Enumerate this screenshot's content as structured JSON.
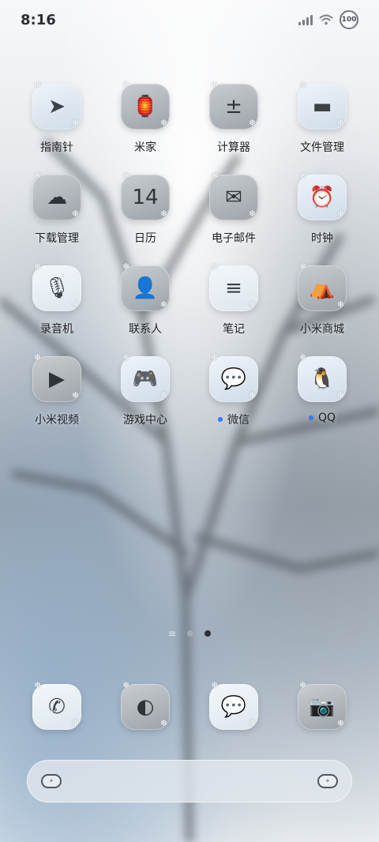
{
  "status": {
    "time": "8:16",
    "battery": "100"
  },
  "apps": [
    {
      "label": "指南针",
      "icon": "compass-icon",
      "glyph": "➤",
      "style": "blue",
      "dot": false
    },
    {
      "label": "米家",
      "icon": "lamp-icon",
      "glyph": "🏮",
      "style": "dark",
      "dot": false
    },
    {
      "label": "计算器",
      "icon": "calculator-icon",
      "glyph": "±",
      "style": "dark",
      "dot": false
    },
    {
      "label": "文件管理",
      "icon": "folder-icon",
      "glyph": "▬",
      "style": "blue",
      "dot": false
    },
    {
      "label": "下载管理",
      "icon": "cloud-download-icon",
      "glyph": "☁",
      "style": "dark",
      "dot": false
    },
    {
      "label": "日历",
      "icon": "calendar-icon",
      "glyph": "14",
      "style": "dark",
      "dot": false
    },
    {
      "label": "电子邮件",
      "icon": "mail-icon",
      "glyph": "✉",
      "style": "dark",
      "dot": false
    },
    {
      "label": "时钟",
      "icon": "alarm-clock-icon",
      "glyph": "⏰",
      "style": "blue",
      "dot": false
    },
    {
      "label": "录音机",
      "icon": "microphone-icon",
      "glyph": "🎙",
      "style": "light",
      "dot": false
    },
    {
      "label": "联系人",
      "icon": "contact-icon",
      "glyph": "👤",
      "style": "dark",
      "dot": false
    },
    {
      "label": "笔记",
      "icon": "notes-icon",
      "glyph": "≡",
      "style": "light",
      "dot": false
    },
    {
      "label": "小米商城",
      "icon": "store-icon",
      "glyph": "⛺",
      "style": "dark",
      "dot": false
    },
    {
      "label": "小米视频",
      "icon": "video-icon",
      "glyph": "▶",
      "style": "dark",
      "dot": false
    },
    {
      "label": "游戏中心",
      "icon": "gamepad-icon",
      "glyph": "🎮",
      "style": "blue",
      "dot": false
    },
    {
      "label": "微信",
      "icon": "wechat-icon",
      "glyph": "💬",
      "style": "blue",
      "dot": true
    },
    {
      "label": "QQ",
      "icon": "qq-penguin-icon",
      "glyph": "🐧",
      "style": "blue",
      "dot": true
    }
  ],
  "dock": [
    {
      "icon": "phone-icon",
      "glyph": "✆",
      "style": "light"
    },
    {
      "icon": "browser-icon",
      "glyph": "◐",
      "style": "dark"
    },
    {
      "icon": "messages-icon",
      "glyph": "💬",
      "style": "light"
    },
    {
      "icon": "camera-icon",
      "glyph": "📷",
      "style": "dark"
    }
  ],
  "pager": {
    "pages": 2,
    "active": 2
  },
  "colors": {
    "notification_dot": "#2f7bf5"
  }
}
